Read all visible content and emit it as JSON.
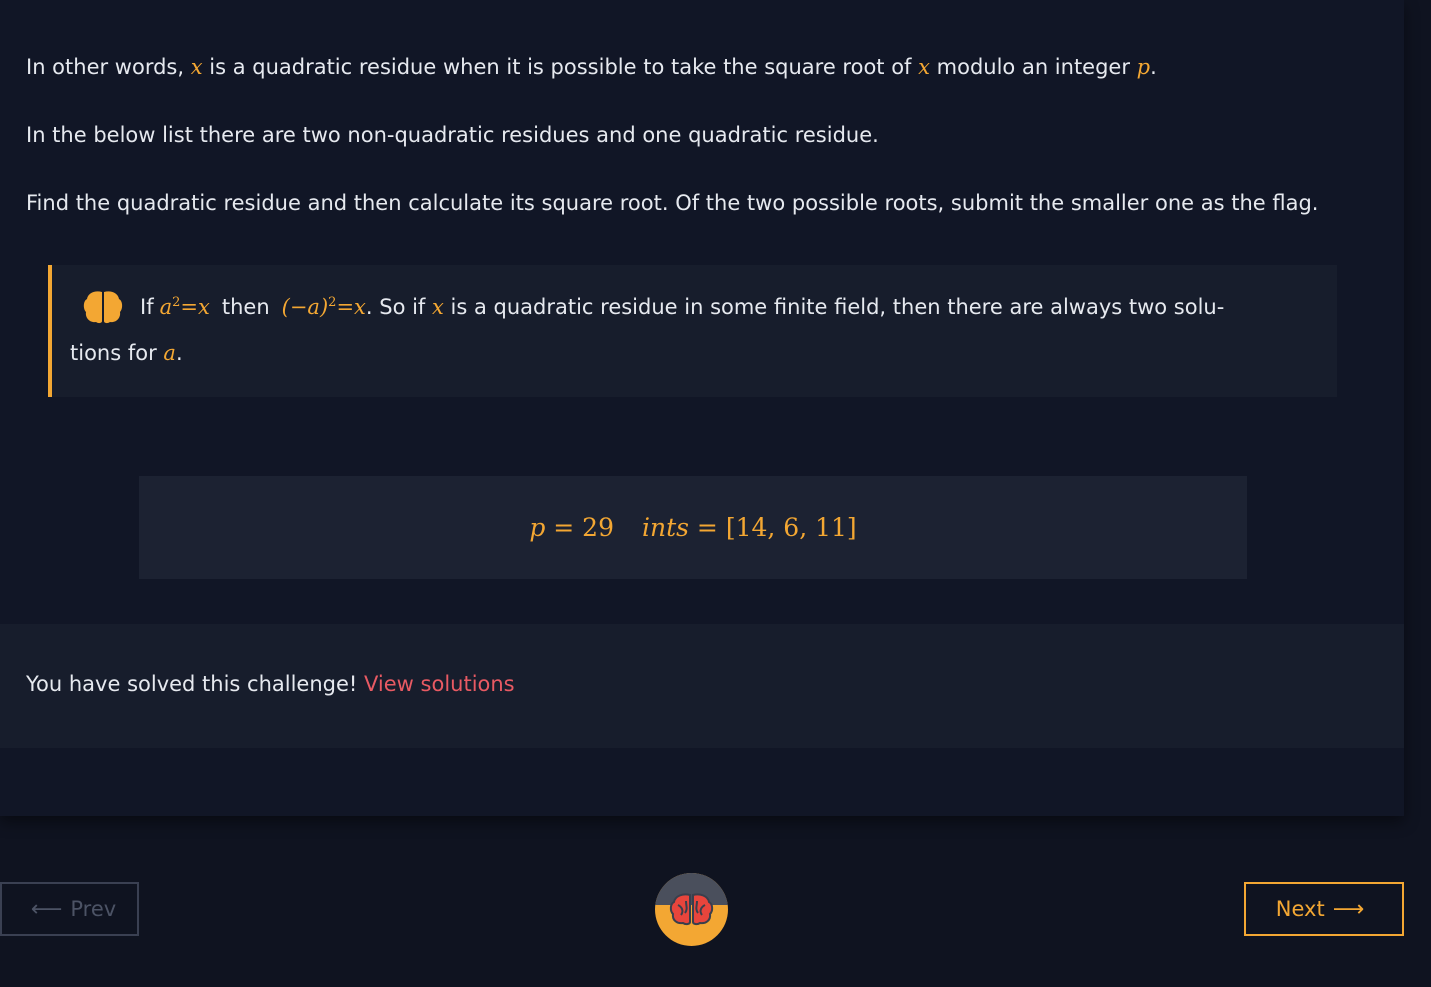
{
  "content": {
    "p1": {
      "a": "In other words, ",
      "x1": "x",
      "b": " is a quadratic residue when it is possible to take the square root of ",
      "x2": "x",
      "c": " modulo an integer ",
      "p": "p",
      "d": "."
    },
    "p2": "In the below list there are two non-quadratic residues and one quadratic residue.",
    "p3": "Find the quadratic residue and then calculate its square root. Of the two possible roots, submit the smaller one as the flag."
  },
  "hint": {
    "if_word": "If",
    "a": "a",
    "exp1": "2",
    "eq1": " = ",
    "x1": "x",
    "then_word": "then",
    "neg_a": "(−a)",
    "exp2": "2",
    "eq2": " = ",
    "x2": "x",
    "rest1": ". So if ",
    "x3": "x",
    "rest2": " is a quadratic residue in some finite field, then there are always two solu-",
    "line2_text": "tions for ",
    "a2": "a",
    "period": "."
  },
  "data_box": {
    "p_label": "p",
    "p_eq": " = 29",
    "ints_label": "ints",
    "ints_eq": " = [14, 6, 11]"
  },
  "status": {
    "solved_text": "You have solved this challenge! ",
    "view_solutions": "View solutions"
  },
  "nav": {
    "prev_label": "Prev",
    "next_label": "Next"
  },
  "colors": {
    "accent": "#f3a733",
    "link": "#e85a63",
    "background": "#0f1320"
  }
}
